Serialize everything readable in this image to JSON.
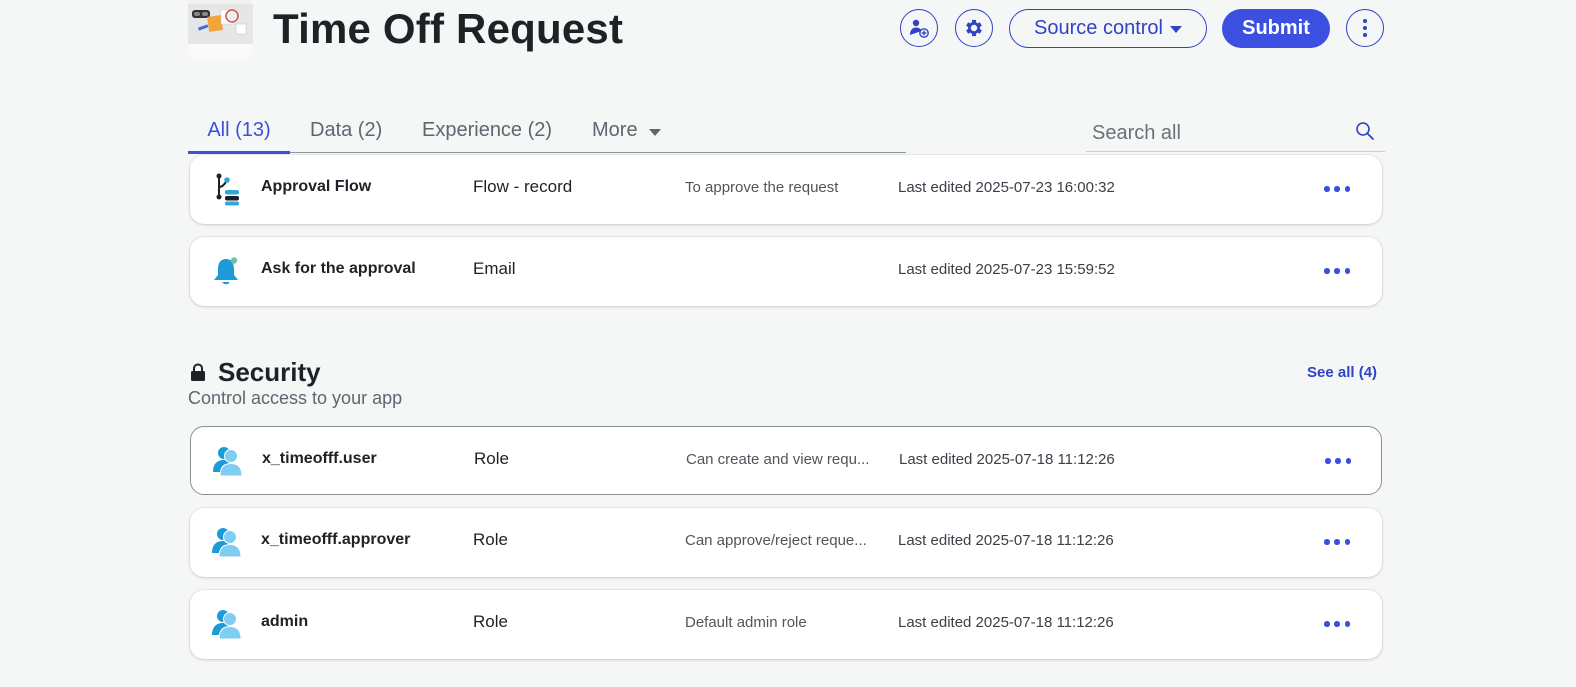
{
  "header": {
    "title": "Time Off Request",
    "actions": {
      "add_user_icon": "add-user-icon",
      "settings_icon": "gear-icon",
      "source_control_label": "Source control",
      "submit_label": "Submit",
      "more_icon": "more-vertical-icon"
    },
    "accent_color": "#3b50e0"
  },
  "tabs": [
    {
      "label": "All (13)",
      "active": true
    },
    {
      "label": "Data (2)",
      "active": false
    },
    {
      "label": "Experience (2)",
      "active": false
    },
    {
      "label": "More",
      "active": false
    }
  ],
  "search": {
    "placeholder": "Search all",
    "value": ""
  },
  "logic_items": [
    {
      "name": "Approval Flow",
      "type": "Flow - record",
      "description": "To approve the request",
      "edited": "Last edited 2025-07-23 16:00:32",
      "icon": "flow-icon"
    },
    {
      "name": "Ask for the approval",
      "type": "Email",
      "description": "",
      "edited": "Last edited 2025-07-23 15:59:52",
      "icon": "bell-icon"
    }
  ],
  "security": {
    "title": "Security",
    "subtitle": "Control access to your app",
    "see_all": "See all (4)",
    "items": [
      {
        "name": "x_timeofff.user",
        "type": "Role",
        "description": "Can create and view requ...",
        "edited": "Last edited 2025-07-18 11:12:26",
        "icon": "role-icon",
        "selected": true
      },
      {
        "name": "x_timeofff.approver",
        "type": "Role",
        "description": "Can approve/reject reque...",
        "edited": "Last edited 2025-07-18 11:12:26",
        "icon": "role-icon",
        "selected": false
      },
      {
        "name": "admin",
        "type": "Role",
        "description": "Default admin role",
        "edited": "Last edited 2025-07-18 11:12:26",
        "icon": "role-icon",
        "selected": false
      }
    ]
  }
}
